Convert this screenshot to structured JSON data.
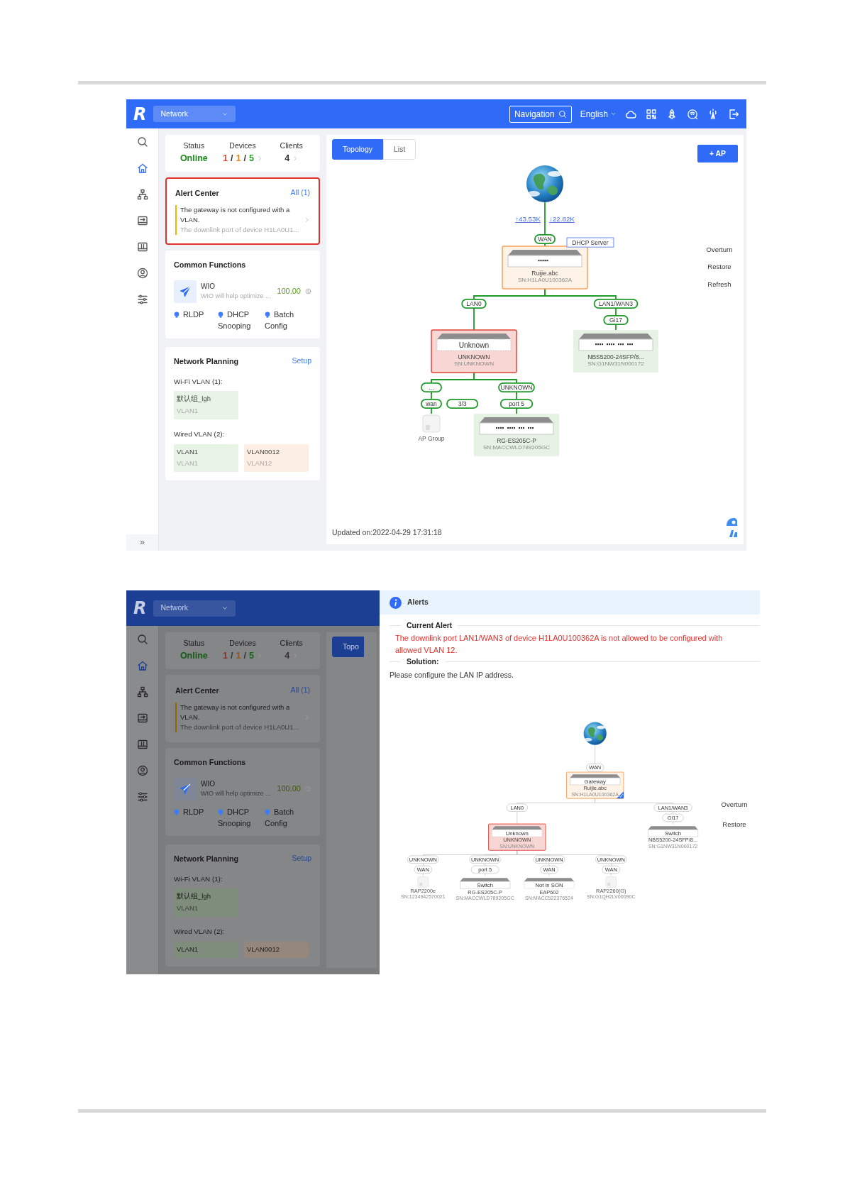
{
  "screens": [
    {
      "dimmed": false,
      "header": {
        "logo": "R",
        "network_menu": "Network",
        "navigation": "Navigation",
        "language": "English"
      },
      "sidebar": [
        {
          "selected": false
        },
        {
          "selected": true
        },
        {
          "selected": false
        },
        {
          "selected": false
        },
        {
          "selected": false
        },
        {
          "selected": false
        },
        {
          "selected": false
        }
      ],
      "sidebar_expand": "»",
      "summary": {
        "status_label": "Status",
        "status_value": "Online",
        "devices_label": "Devices",
        "devices": [
          {
            "value": "1",
            "color": "#e5462f"
          },
          {
            "value": "1",
            "color": "#f0841d"
          },
          {
            "value": "5",
            "color": "#2a9b2a"
          }
        ],
        "separator": "/",
        "clients_label": "Clients",
        "clients_value": "4"
      },
      "alert_center": {
        "title": "Alert Center",
        "all_link": "All (1)",
        "message": "The gateway is not configured with a VLAN.",
        "detail": "The downlink port of device H1LA0U1...",
        "highlighted": true
      },
      "common_functions": {
        "title": "Common Functions",
        "wio": {
          "name": "WIO",
          "description": "WIO will help optimize ...",
          "score": "100.00"
        },
        "items": [
          "RLDP",
          "DHCP Snooping",
          "Batch Config"
        ]
      },
      "network_planning": {
        "title": "Network Planning",
        "setup_link": "Setup",
        "wifi_label": "Wi-Fi VLAN (1):",
        "wifi_vlans": [
          {
            "name": "默认组_lgh",
            "vlan": "VLAN1",
            "color": "#e8f5e6"
          }
        ],
        "wired_label": "Wired VLAN (2):",
        "wired_vlans": [
          {
            "name": "VLAN1",
            "vlan": "VLAN1",
            "color": "#e8f5e6"
          },
          {
            "name": "VLAN0012",
            "vlan": "VLAN12",
            "color": "#fdeee3"
          }
        ]
      },
      "tabs": [
        {
          "label": "Topology",
          "selected": true
        },
        {
          "label": "List",
          "selected": false
        }
      ],
      "add_ap": "+ AP",
      "topology": {
        "links_active": true,
        "root": {
          "kind": "internet",
          "upload": "↑43.53K",
          "download": "↓22.82K",
          "children": [
            {
              "kind": "gateway",
              "ports": [
                "WAN"
              ],
              "badge": "DHCP Server",
              "name": "Ruijie.abc",
              "sn": "SN:H1LA0U100362A",
              "children": [
                {
                  "kind": "unknown",
                  "ports": [
                    "LAN0"
                  ],
                  "bar_text": "Unknown",
                  "name": "UNKNOWN",
                  "sn": "SN:UNKNOWN",
                  "children": [
                    {
                      "kind": "ap_group",
                      "ports": [
                        "...",
                        "wan"
                      ],
                      "count": "3/3",
                      "name": "AP Group"
                    },
                    {
                      "kind": "switch",
                      "online": true,
                      "ports": [
                        "UNKNOWN",
                        "port 5"
                      ],
                      "name": "RG-ES205C-P",
                      "sn": "SN:MACCWLD789205GC"
                    }
                  ]
                },
                {
                  "kind": "switch",
                  "online": true,
                  "ports": [
                    "LAN1/WAN3",
                    "Gi17"
                  ],
                  "name": "NBS5200-24SFP/8...",
                  "sn": "SN:G1NW31N000172"
                }
              ]
            }
          ]
        }
      },
      "actions": [
        "Overturn",
        "Restore",
        "Refresh"
      ],
      "updated": "Updated on:2022-04-29 17:31:18"
    },
    {
      "dimmed": true,
      "header": {
        "logo": "R",
        "network_menu": "Network"
      },
      "sidebar": [
        {
          "selected": false
        },
        {
          "selected": true
        },
        {
          "selected": false
        },
        {
          "selected": false
        },
        {
          "selected": false
        },
        {
          "selected": false
        },
        {
          "selected": false
        }
      ],
      "summary": {
        "status_label": "Status",
        "status_value": "Online",
        "devices_label": "Devices",
        "devices": [
          {
            "value": "1",
            "color": "#8a2e20"
          },
          {
            "value": "1",
            "color": "#8f561a"
          },
          {
            "value": "5",
            "color": "#1c641c"
          }
        ],
        "separator": "/",
        "clients_label": "Clients",
        "clients_value": "4"
      },
      "alert_center": {
        "title": "Alert Center",
        "all_link": "All (1)",
        "message": "The gateway is not configured with a VLAN.",
        "detail": "The downlink port of device H1LA0U1...",
        "highlighted": false
      },
      "common_functions": {
        "title": "Common Functions",
        "wio": {
          "name": "WIO",
          "description": "WIO will help optimize ...",
          "score": "100.00"
        },
        "items": [
          "RLDP",
          "DHCP Snooping",
          "Batch Config"
        ]
      },
      "network_planning": {
        "title": "Network Planning",
        "setup_link": "Setup",
        "wifi_label": "Wi-Fi VLAN (1):",
        "wifi_vlans": [
          {
            "name": "默认组_lgh",
            "vlan": "VLAN1",
            "color": "#7f8d7c"
          }
        ],
        "wired_label": "Wired VLAN (2):",
        "wired_vlans": [
          {
            "name": "VLAN1",
            "color": "#7f8d7c"
          },
          {
            "name": "VLAN0012",
            "color": "#95877c"
          }
        ]
      },
      "tabs": [
        {
          "label": "Topo",
          "selected": true
        }
      ],
      "drawer": {
        "title": "Alerts",
        "current_label": "Current Alert",
        "alert_text": "The downlink port LAN1/WAN3 of device H1LA0U100362A is not allowed to be configured with allowed VLAN 12.",
        "solution_label": "Solution:",
        "solution_text": "Please configure the LAN IP address.",
        "topology": {
          "links_active": false,
          "root": {
            "kind": "internet",
            "children": [
              {
                "kind": "gateway",
                "selected": true,
                "ports": [
                  "WAN"
                ],
                "bar_text": "Gateway",
                "name": "Ruijie.abc",
                "sn": "SN:H1LA0U100362A",
                "children": [
                  {
                    "kind": "unknown",
                    "selected": false,
                    "ports": [
                      "LAN0"
                    ],
                    "bar_text": "Unknown",
                    "name": "UNKNOWN",
                    "sn": "SN:UNKNOWN",
                    "children": [
                      {
                        "kind": "ap",
                        "selected": false,
                        "ports": [
                          "UNKNOWN",
                          "WAN"
                        ],
                        "name": "RAP2200e",
                        "sn": "SN:1234942570021"
                      },
                      {
                        "kind": "switch",
                        "selected": false,
                        "online": false,
                        "ports": [
                          "UNKNOWN",
                          "port 5"
                        ],
                        "bar_text": "Switch",
                        "name": "RG-ES205C-P",
                        "sn": "SN:MACCWLD789205GC"
                      },
                      {
                        "kind": "not_in_son",
                        "selected": false,
                        "ports": [
                          "UNKNOWN",
                          "WAN"
                        ],
                        "bar_text": "Not in SON",
                        "name": "EAP602",
                        "sn": "SN:MACC522376524"
                      },
                      {
                        "kind": "ap",
                        "selected": false,
                        "ports": [
                          "UNKNOWN",
                          "WAN"
                        ],
                        "name": "RAP2260(G)",
                        "sn": "SN:G1QH2LV00090C"
                      }
                    ]
                  },
                  {
                    "kind": "switch",
                    "selected": false,
                    "online": false,
                    "ports": [
                      "LAN1/WAN3",
                      "Gi17"
                    ],
                    "bar_text": "Switch",
                    "name": "NBS5200-24SFP/8...",
                    "sn": "SN:G1NW31N000172"
                  }
                ]
              }
            ]
          }
        },
        "actions": [
          "Overturn",
          "Restore"
        ]
      }
    }
  ]
}
